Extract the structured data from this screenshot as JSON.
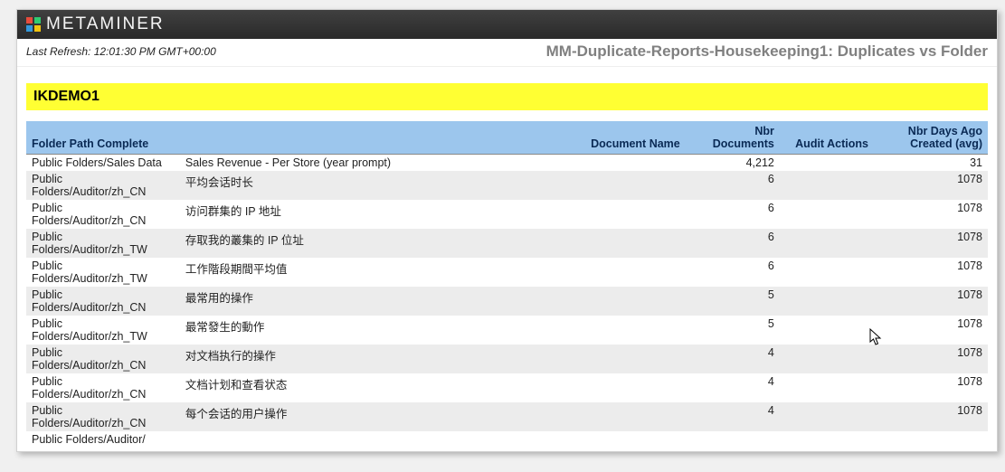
{
  "app": {
    "name": "METAMINER",
    "refresh_label": "Last Refresh: 12:01:30 PM GMT+00:00",
    "page_title": "MM-Duplicate-Reports-Housekeeping1: Duplicates vs Folder"
  },
  "section": {
    "title": "IKDEMO1"
  },
  "columns": {
    "folder_path": "Folder Path Complete",
    "document_name": "Document Name",
    "nbr_documents": "Nbr Documents",
    "audit_actions": "Audit Actions",
    "nbr_days_ago": "Nbr Days Ago Created (avg)"
  },
  "rows": [
    {
      "folder_path": "Public Folders/Sales Data",
      "document_name": "Sales Revenue - Per Store (year prompt)",
      "nbr_documents": "4,212",
      "audit_actions": "",
      "nbr_days_ago": "31"
    },
    {
      "folder_path": "Public Folders/Auditor/zh_CN",
      "document_name": "平均会话时长",
      "nbr_documents": "6",
      "audit_actions": "",
      "nbr_days_ago": "1078"
    },
    {
      "folder_path": "Public Folders/Auditor/zh_CN",
      "document_name": "访问群集的 IP 地址",
      "nbr_documents": "6",
      "audit_actions": "",
      "nbr_days_ago": "1078"
    },
    {
      "folder_path": "Public Folders/Auditor/zh_TW",
      "document_name": "存取我的叢集的 IP 位址",
      "nbr_documents": "6",
      "audit_actions": "",
      "nbr_days_ago": "1078"
    },
    {
      "folder_path": "Public Folders/Auditor/zh_TW",
      "document_name": "工作階段期間平均值",
      "nbr_documents": "6",
      "audit_actions": "",
      "nbr_days_ago": "1078"
    },
    {
      "folder_path": "Public Folders/Auditor/zh_CN",
      "document_name": "最常用的操作",
      "nbr_documents": "5",
      "audit_actions": "",
      "nbr_days_ago": "1078"
    },
    {
      "folder_path": "Public Folders/Auditor/zh_TW",
      "document_name": "最常發生的動作",
      "nbr_documents": "5",
      "audit_actions": "",
      "nbr_days_ago": "1078"
    },
    {
      "folder_path": "Public Folders/Auditor/zh_CN",
      "document_name": "对文档执行的操作",
      "nbr_documents": "4",
      "audit_actions": "",
      "nbr_days_ago": "1078"
    },
    {
      "folder_path": "Public Folders/Auditor/zh_CN",
      "document_name": "文档计划和查看状态",
      "nbr_documents": "4",
      "audit_actions": "",
      "nbr_days_ago": "1078"
    },
    {
      "folder_path": "Public Folders/Auditor/zh_CN",
      "document_name": "每个会话的用户操作",
      "nbr_documents": "4",
      "audit_actions": "",
      "nbr_days_ago": "1078"
    },
    {
      "folder_path": "Public Folders/Auditor/",
      "document_name": "",
      "nbr_documents": "",
      "audit_actions": "",
      "nbr_days_ago": ""
    }
  ]
}
